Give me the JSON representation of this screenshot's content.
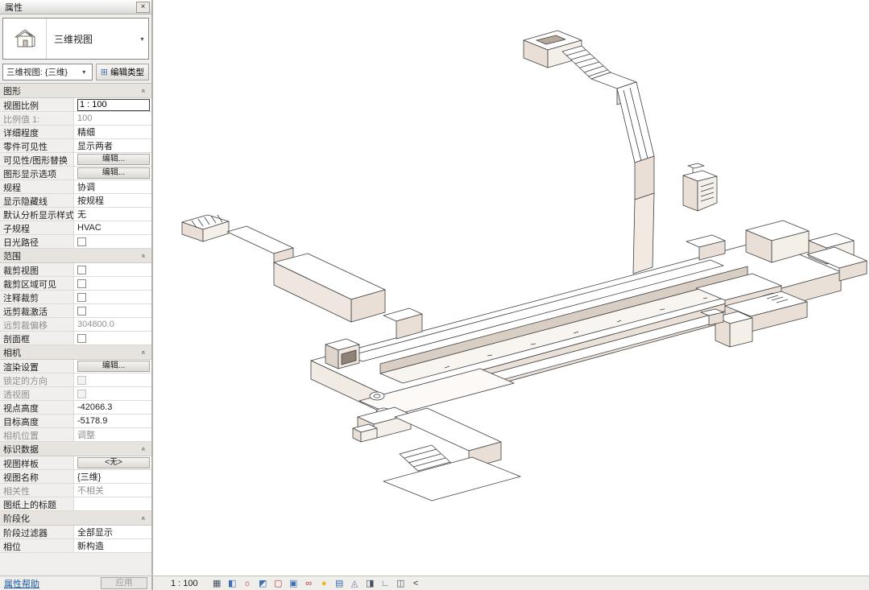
{
  "panel": {
    "title": "属性",
    "type_label": "三维视图",
    "view_selector": "三维视图: {三维}",
    "edit_type_label": "编辑类型",
    "help_label": "属性帮助",
    "apply_label": "应用",
    "sections": [
      {
        "id": "graphics",
        "title": "图形",
        "rows": [
          {
            "label": "视图比例",
            "value": "1 : 100",
            "kind": "input"
          },
          {
            "label": "比例值 1:",
            "value": "100",
            "kind": "text",
            "gray": true
          },
          {
            "label": "详细程度",
            "value": "精细",
            "kind": "text"
          },
          {
            "label": "零件可见性",
            "value": "显示两者",
            "kind": "text"
          },
          {
            "label": "可见性/图形替换",
            "value": "编辑...",
            "kind": "button"
          },
          {
            "label": "图形显示选项",
            "value": "编辑...",
            "kind": "button"
          },
          {
            "label": "规程",
            "value": "协调",
            "kind": "text"
          },
          {
            "label": "显示隐藏线",
            "value": "按规程",
            "kind": "text"
          },
          {
            "label": "默认分析显示样式",
            "value": "无",
            "kind": "text"
          },
          {
            "label": "子规程",
            "value": "HVAC",
            "kind": "text"
          },
          {
            "label": "日光路径",
            "value": "",
            "kind": "checkbox"
          }
        ]
      },
      {
        "id": "extents",
        "title": "范围",
        "rows": [
          {
            "label": "裁剪视图",
            "value": "",
            "kind": "checkbox"
          },
          {
            "label": "裁剪区域可见",
            "value": "",
            "kind": "checkbox"
          },
          {
            "label": "注释裁剪",
            "value": "",
            "kind": "checkbox"
          },
          {
            "label": "远剪裁激活",
            "value": "",
            "kind": "checkbox"
          },
          {
            "label": "远剪裁偏移",
            "value": "304800.0",
            "kind": "text",
            "gray": true
          },
          {
            "label": "剖面框",
            "value": "",
            "kind": "checkbox"
          }
        ]
      },
      {
        "id": "camera",
        "title": "相机",
        "rows": [
          {
            "label": "渲染设置",
            "value": "编辑...",
            "kind": "button"
          },
          {
            "label": "锁定的方向",
            "value": "",
            "kind": "checkbox",
            "gray": true
          },
          {
            "label": "透视图",
            "value": "",
            "kind": "checkbox",
            "gray": true
          },
          {
            "label": "视点高度",
            "value": "-42066.3",
            "kind": "text"
          },
          {
            "label": "目标高度",
            "value": "-5178.9",
            "kind": "text"
          },
          {
            "label": "相机位置",
            "value": "调整",
            "kind": "text",
            "gray": true
          }
        ]
      },
      {
        "id": "identity",
        "title": "标识数据",
        "rows": [
          {
            "label": "视图样板",
            "value": "<无>",
            "kind": "button"
          },
          {
            "label": "视图名称",
            "value": "{三维}",
            "kind": "text"
          },
          {
            "label": "相关性",
            "value": "不相关",
            "kind": "text",
            "gray": true
          },
          {
            "label": "图纸上的标题",
            "value": "",
            "kind": "text"
          }
        ]
      },
      {
        "id": "phasing",
        "title": "阶段化",
        "rows": [
          {
            "label": "阶段过滤器",
            "value": "全部显示",
            "kind": "text"
          },
          {
            "label": "相位",
            "value": "新构造",
            "kind": "text"
          }
        ]
      }
    ]
  },
  "icons": {
    "close": "×",
    "dropdown": "▾",
    "combo_dropdown": "▾",
    "section_collapse": "«",
    "edit_type": "⊞"
  },
  "statusbar": {
    "scale": "1 : 100",
    "icons": [
      {
        "name": "detail-level",
        "glyph": "▦",
        "color": "#44525f"
      },
      {
        "name": "visual-style",
        "glyph": "◧",
        "color": "#3f6fae"
      },
      {
        "name": "sun-path",
        "glyph": "☼",
        "color": "#b8352f"
      },
      {
        "name": "shadows",
        "glyph": "◩",
        "color": "#3f6fae"
      },
      {
        "name": "crop-view",
        "glyph": "▢",
        "color": "#b8352f"
      },
      {
        "name": "show-crop-region",
        "glyph": "▣",
        "color": "#3f6fae"
      },
      {
        "name": "temporary-hide-isolate",
        "glyph": "∞",
        "color": "#b8352f"
      },
      {
        "name": "reveal-hidden-elements",
        "glyph": "●",
        "color": "#e3b921"
      },
      {
        "name": "temporary-view-properties",
        "glyph": "▤",
        "color": "#3f6fae"
      },
      {
        "name": "show-analytical-model",
        "glyph": "◬",
        "color": "#8a6ca8"
      },
      {
        "name": "highlight-displacement-sets",
        "glyph": "◨",
        "color": "#44525f"
      },
      {
        "name": "reveal-constraints",
        "glyph": "∟",
        "color": "#3f6fae"
      },
      {
        "name": "worksharing-display",
        "glyph": "◫",
        "color": "#44525f"
      },
      {
        "name": "expand-chevron",
        "glyph": "<",
        "color": "#333333"
      }
    ]
  },
  "model": {
    "edge_color": "#3f3f3f",
    "shade_color": "#e9dfd7",
    "accent_green": "#2fae3a"
  }
}
